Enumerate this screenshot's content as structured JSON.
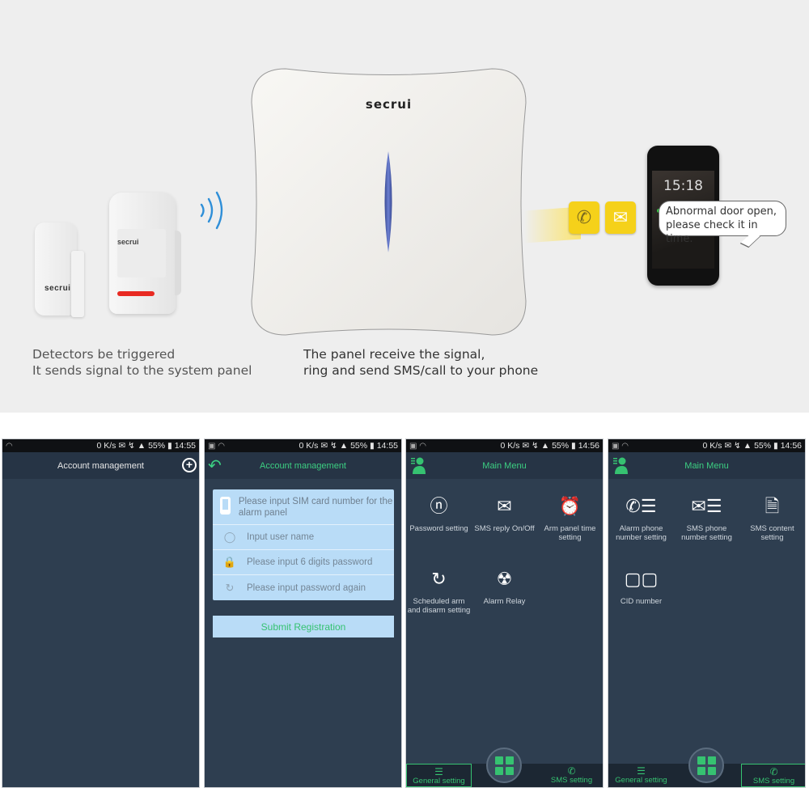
{
  "illustration": {
    "brand": "secrui",
    "caption_left": [
      "Detectors be triggered",
      "It sends signal to the system panel"
    ],
    "caption_mid": [
      "The panel receive the signal,",
      "ring and send SMS/call to your phone"
    ],
    "phone_time": "15:18",
    "notification": [
      "Abnormal door open,",
      "please check it in time."
    ],
    "icons": [
      "wireless-signal-icon",
      "phone-call-icon",
      "envelope-icon"
    ]
  },
  "status_bar": {
    "speed": "0 K/s",
    "battery": "55%",
    "times": [
      "14:55",
      "14:55",
      "14:56",
      "14:56"
    ]
  },
  "screen1": {
    "title": "Account management",
    "add_icon": "plus-circle-icon"
  },
  "screen2": {
    "title": "Account management",
    "back_icon": "back-arrow-icon",
    "fields": [
      {
        "icon": "phone-icon",
        "placeholder": "Please input SIM card number for the alarm panel",
        "value": ""
      },
      {
        "icon": "user-icon",
        "placeholder": "Input user name",
        "value": ""
      },
      {
        "icon": "lock-icon",
        "placeholder": "Please input 6 digits password",
        "value": ""
      },
      {
        "icon": "lock-repeat-icon",
        "placeholder": "Please input password again",
        "value": ""
      }
    ],
    "submit_label": "Submit Registration"
  },
  "screen3": {
    "title": "Main Menu",
    "items": [
      {
        "icon": "keyhole-icon",
        "label": "Password setting"
      },
      {
        "icon": "envelope-icon",
        "label": "SMS reply On/Off"
      },
      {
        "icon": "alarm-clock-icon",
        "label": "Arm panel time setting"
      },
      {
        "icon": "timer-icon",
        "label": "Scheduled arm and disarm setting"
      },
      {
        "icon": "radiation-icon",
        "label": "Alarm Relay"
      }
    ],
    "active_tab": "general"
  },
  "screen4": {
    "title": "Main Menu",
    "items": [
      {
        "icon": "phone-list-icon",
        "label": "Alarm phone number setting"
      },
      {
        "icon": "sms-list-icon",
        "label": "SMS phone number setting"
      },
      {
        "icon": "document-search-icon",
        "label": "SMS content setting"
      },
      {
        "icon": "monitors-icon",
        "label": "CID number"
      }
    ],
    "active_tab": "sms"
  },
  "bottom_tabs": {
    "general": "General setting",
    "sms": "SMS setting"
  },
  "colors": {
    "accent_green": "#36c271",
    "screen_bg": "#2e3e50",
    "form_bg": "#b9dcf7",
    "panel_led": "#4a5aa8",
    "notify_yellow": "#f5d11a"
  }
}
